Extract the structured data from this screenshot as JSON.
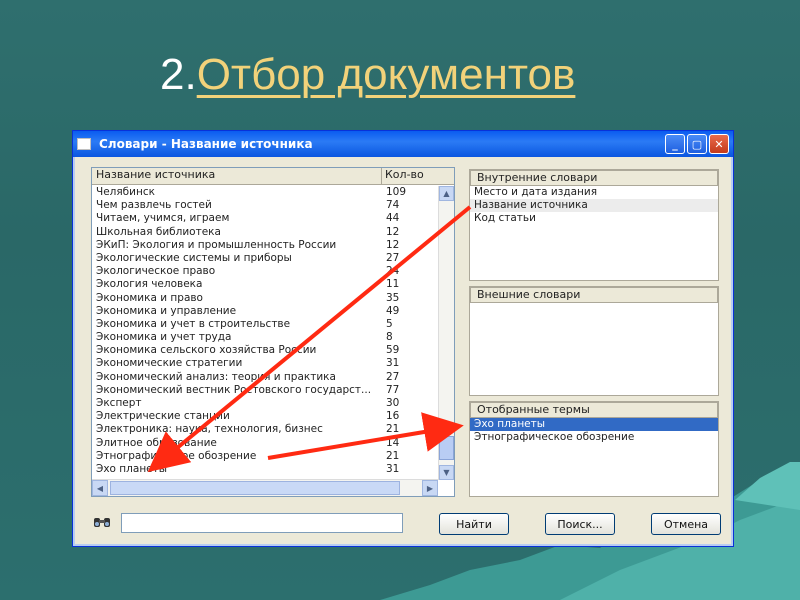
{
  "slide": {
    "number": "2.",
    "title": "Отбор документов"
  },
  "window": {
    "title": "Словари - Название источника"
  },
  "list": {
    "col_name": "Название источника",
    "col_count": "Кол-во",
    "rows": [
      {
        "name": "Челябинск",
        "count": "109"
      },
      {
        "name": "Чем развлечь гостей",
        "count": "74"
      },
      {
        "name": "Читаем, учимся, играем",
        "count": "44"
      },
      {
        "name": "Школьная библиотека",
        "count": "12"
      },
      {
        "name": "ЭКиП: Экология и промышленность России",
        "count": "12"
      },
      {
        "name": "Экологические системы и приборы",
        "count": "27"
      },
      {
        "name": "Экологическое право",
        "count": "24"
      },
      {
        "name": "Экология человека",
        "count": "11"
      },
      {
        "name": "Экономика и право",
        "count": "35"
      },
      {
        "name": "Экономика и управление",
        "count": "49"
      },
      {
        "name": "Экономика и учет в строительстве",
        "count": "5"
      },
      {
        "name": "Экономика и учет труда",
        "count": "8"
      },
      {
        "name": "Экономика сельского хозяйства России",
        "count": "59"
      },
      {
        "name": "Экономические стратегии",
        "count": "31"
      },
      {
        "name": "Экономический анализ: теория и практика",
        "count": "27"
      },
      {
        "name": "Экономический вестник Ростовского государст...",
        "count": "77"
      },
      {
        "name": "Эксперт",
        "count": "30"
      },
      {
        "name": "Электрические станции",
        "count": "16"
      },
      {
        "name": "Электроника: наука, технология, бизнес",
        "count": "21"
      },
      {
        "name": "Элитное образование",
        "count": "14"
      },
      {
        "name": "Этнографическое обозрение",
        "count": "21"
      },
      {
        "name": "Эхо планеты",
        "count": "31"
      }
    ]
  },
  "internal": {
    "header": "Внутренние словари",
    "items": [
      "Место и дата издания",
      "Название источника",
      "Код статьи"
    ]
  },
  "external": {
    "header": "Внешние словари"
  },
  "selected": {
    "header": "Отобранные термы",
    "items": [
      "Эхо планеты",
      "Этнографическое обозрение"
    ]
  },
  "buttons": {
    "find": "Найти",
    "search": "Поиск...",
    "cancel": "Отмена"
  },
  "colors": {
    "accent": "#f2d27a",
    "selection": "#316ac5",
    "arrow": "#ff2a12"
  }
}
